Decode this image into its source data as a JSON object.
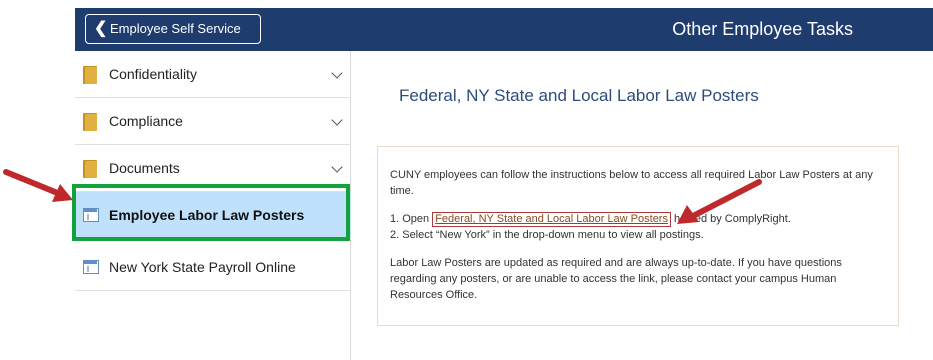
{
  "header": {
    "back_label": "Employee Self Service",
    "title": "Other Employee Tasks",
    "background_color": "#1f3c6e"
  },
  "sidebar": {
    "items": [
      {
        "label": "Confidentiality",
        "icon": "folder-icon",
        "expandable": true
      },
      {
        "label": "Compliance",
        "icon": "folder-icon",
        "expandable": true
      },
      {
        "label": "Documents",
        "icon": "folder-icon",
        "expandable": true
      },
      {
        "label": "Employee Labor Law Posters",
        "icon": "page-icon",
        "selected": true
      },
      {
        "label": "New York State Payroll Online",
        "icon": "page-icon"
      }
    ],
    "selected_color": "#bfe1fb",
    "highlight_color": "#12a33c"
  },
  "main": {
    "title": "Federal, NY State and Local Labor Law Posters",
    "intro": "CUNY employees can follow the instructions below to access all required Labor Law Posters at any time.",
    "step1_prefix": "1. Open ",
    "step1_link": "Federal, NY State and Local Labor Law Posters",
    "step1_suffix": " hosted by ComplyRight.",
    "step2": "2. Select “New York” in the drop-down menu to view all postings.",
    "footer": "Labor Law Posters are updated as required and are always up-to-date. If you have questions regarding any posters, or are unable to access the link, please contact your campus Human Resources Office."
  },
  "annotation_color": "#c0292b"
}
